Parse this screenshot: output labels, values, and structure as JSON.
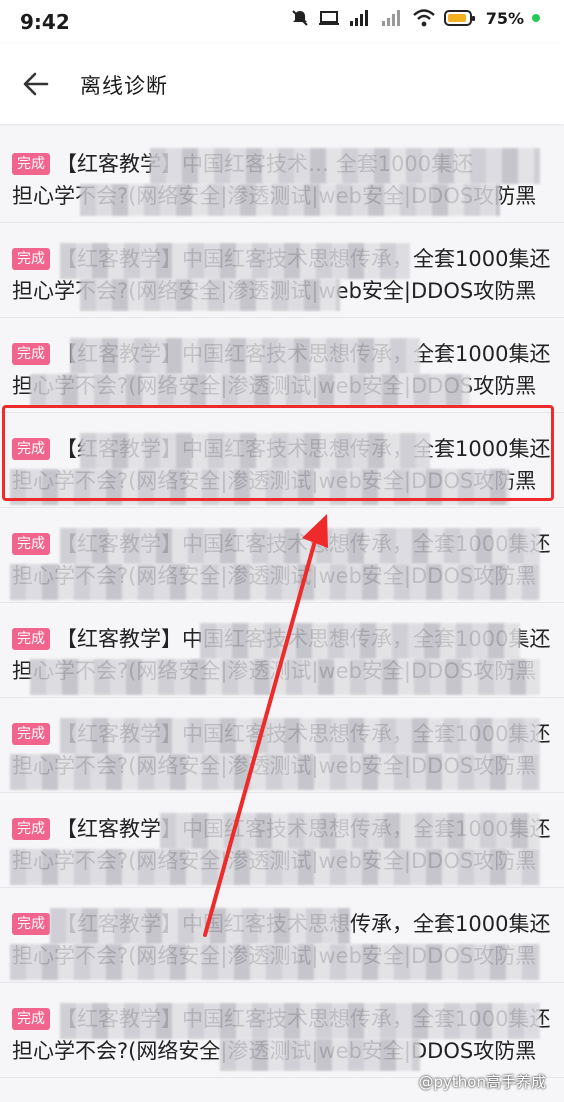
{
  "status": {
    "time": "9:42",
    "battery": "75%"
  },
  "header": {
    "title": "离线诊断"
  },
  "badge_label": "完成",
  "items": [
    {
      "line1": "【红客教学】中国红客技术… 全套1000集还",
      "line2": "担心学不会?(网络安全|渗透测试|web安全|DDOS攻防黑"
    },
    {
      "line1": "【红客教学】中国红客技术思想传承，全套1000集还",
      "line2": "担心学不会?(网络安全|渗透测试|web安全|DDOS攻防黑"
    },
    {
      "line1": "【红客教学】中国红客技术思想传承，全套1000集还",
      "line2": "担心学不会?(网络安全|渗透测试|web安全|DDOS攻防黑"
    },
    {
      "line1": "【红客教学】中国红客技术思想传承，全套1000集还",
      "line2": "担心学不会?(网络安全|渗透测试|web安全|DDOS攻防黑"
    },
    {
      "line1": "【红客教学】中国红客技术思想传承，全套1000集还",
      "line2": "担心学不会?(网络安全|渗透测试|web安全|DDOS攻防黑"
    },
    {
      "line1": "【红客教学】中国红客技术思想传承，全套1000集还",
      "line2": "担心学不会?(网络安全|渗透测试|web安全|DDOS攻防黑"
    },
    {
      "line1": "【红客教学】中国红客技术思想传承，全套1000集还",
      "line2": "担心学不会?(网络安全|渗透测试|web安全|DDOS攻防黑"
    },
    {
      "line1": "【红客教学】中国红客技术思想传承，全套1000集还",
      "line2": "担心学不会?(网络安全|渗透测试|web安全|DDOS攻防黑"
    },
    {
      "line1": "【红客教学】中国红客技术思想传承，全套1000集还",
      "line2": "担心学不会?(网络安全|渗透测试|web安全|DDOS攻防黑"
    },
    {
      "line1": "【红客教学】中国红客技术思想传承，全套1000集还",
      "line2": "担心学不会?(网络安全|渗透测试|web安全|DDOS攻防黑"
    }
  ],
  "watermark": "@python高手养成",
  "colors": {
    "badge": "#f0648e",
    "highlight": "#ee2a2a",
    "battery": "#f2b01e"
  }
}
